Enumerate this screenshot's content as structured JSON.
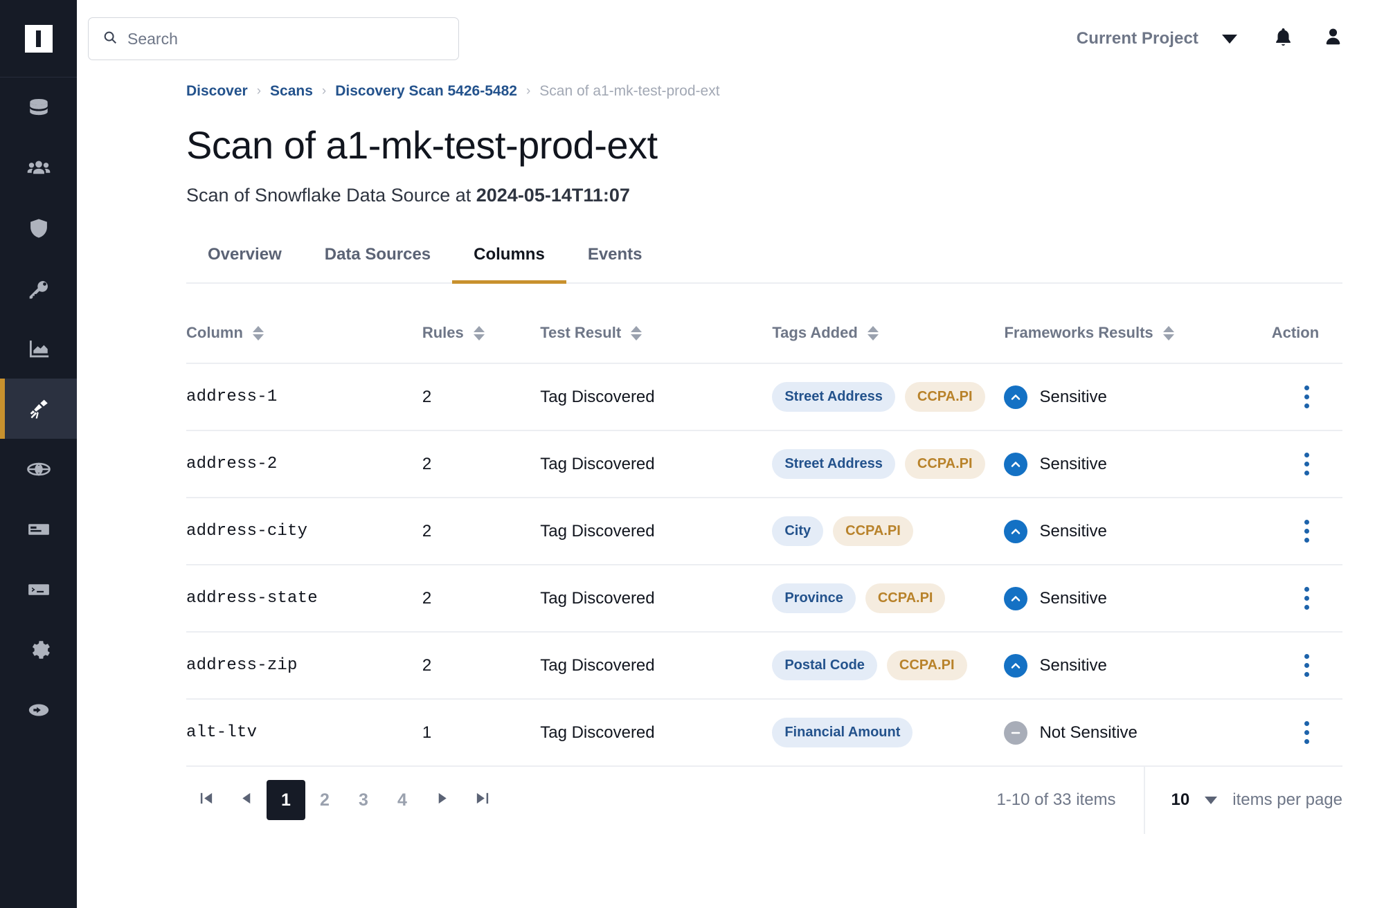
{
  "sidebar": {
    "logo_name": "immuta-logo",
    "items": [
      {
        "name": "data-sources",
        "icon": "database-icon",
        "active": false
      },
      {
        "name": "people",
        "icon": "people-icon",
        "active": false
      },
      {
        "name": "policies",
        "icon": "shield-icon",
        "active": false
      },
      {
        "name": "access",
        "icon": "key-icon",
        "active": false
      },
      {
        "name": "analytics",
        "icon": "chart-icon",
        "active": false
      },
      {
        "name": "discover",
        "icon": "telescope-icon",
        "active": true
      },
      {
        "name": "globe",
        "icon": "globe-icon",
        "active": false
      },
      {
        "name": "documents",
        "icon": "document-icon",
        "active": false
      },
      {
        "name": "terminal",
        "icon": "terminal-icon",
        "active": false
      },
      {
        "name": "settings",
        "icon": "gear-icon",
        "active": false
      },
      {
        "name": "logout",
        "icon": "arrow-right-circle-icon",
        "active": false
      }
    ]
  },
  "topbar": {
    "search_placeholder": "Search",
    "search_value": "",
    "search_icon": "search-icon",
    "project_label": "Current Project",
    "project_caret_icon": "chevron-down-icon",
    "notifications_icon": "bell-icon",
    "account_icon": "user-icon"
  },
  "breadcrumb": {
    "items": [
      {
        "label": "Discover",
        "link": true
      },
      {
        "label": "Scans",
        "link": true
      },
      {
        "label": "Discovery Scan 5426-5482",
        "link": true
      },
      {
        "label": "Scan of a1-mk-test-prod-ext",
        "link": false
      }
    ],
    "separator": "›"
  },
  "page": {
    "title": "Scan of a1-mk-test-prod-ext",
    "subtitle_prefix": "Scan of Snowflake Data Source at ",
    "subtitle_timestamp": "2024-05-14T11:07"
  },
  "tabs": [
    {
      "label": "Overview",
      "active": false
    },
    {
      "label": "Data Sources",
      "active": false
    },
    {
      "label": "Columns",
      "active": true
    },
    {
      "label": "Events",
      "active": false
    }
  ],
  "table": {
    "headers": [
      {
        "label": "Column",
        "sortable": true
      },
      {
        "label": "Rules",
        "sortable": true
      },
      {
        "label": "Test Result",
        "sortable": true
      },
      {
        "label": "Tags Added",
        "sortable": true
      },
      {
        "label": "Frameworks Results",
        "sortable": true
      },
      {
        "label": "Action",
        "sortable": false
      }
    ],
    "rows": [
      {
        "column": "address-1",
        "rules": "2",
        "test_result": "Tag Discovered",
        "tags": [
          {
            "label": "Street Address",
            "kind": "blue"
          },
          {
            "label": "CCPA.PI",
            "kind": "gold"
          }
        ],
        "framework": {
          "label": "Sensitive",
          "state": "sensitive",
          "icon": "chevron-up-circle-icon"
        }
      },
      {
        "column": "address-2",
        "rules": "2",
        "test_result": "Tag Discovered",
        "tags": [
          {
            "label": "Street Address",
            "kind": "blue"
          },
          {
            "label": "CCPA.PI",
            "kind": "gold"
          }
        ],
        "framework": {
          "label": "Sensitive",
          "state": "sensitive",
          "icon": "chevron-up-circle-icon"
        }
      },
      {
        "column": "address-city",
        "rules": "2",
        "test_result": "Tag Discovered",
        "tags": [
          {
            "label": "City",
            "kind": "blue"
          },
          {
            "label": "CCPA.PI",
            "kind": "gold"
          }
        ],
        "framework": {
          "label": "Sensitive",
          "state": "sensitive",
          "icon": "chevron-up-circle-icon"
        }
      },
      {
        "column": "address-state",
        "rules": "2",
        "test_result": "Tag Discovered",
        "tags": [
          {
            "label": "Province",
            "kind": "blue"
          },
          {
            "label": "CCPA.PI",
            "kind": "gold"
          }
        ],
        "framework": {
          "label": "Sensitive",
          "state": "sensitive",
          "icon": "chevron-up-circle-icon"
        }
      },
      {
        "column": "address-zip",
        "rules": "2",
        "test_result": "Tag Discovered",
        "tags": [
          {
            "label": "Postal Code",
            "kind": "blue"
          },
          {
            "label": "CCPA.PI",
            "kind": "gold"
          }
        ],
        "framework": {
          "label": "Sensitive",
          "state": "sensitive",
          "icon": "chevron-up-circle-icon"
        }
      },
      {
        "column": "alt-ltv",
        "rules": "1",
        "test_result": "Tag Discovered",
        "tags": [
          {
            "label": "Financial Amount",
            "kind": "blue"
          }
        ],
        "framework": {
          "label": "Not Sensitive",
          "state": "not-sensitive",
          "icon": "minus-circle-icon"
        }
      }
    ],
    "row_action_icon": "kebab-menu-icon"
  },
  "pagination": {
    "first_icon": "first-page-icon",
    "prev_icon": "previous-page-icon",
    "next_icon": "next-page-icon",
    "last_icon": "last-page-icon",
    "pages": [
      "1",
      "2",
      "3",
      "4"
    ],
    "current_page": "1",
    "range_text": "1-10 of 33 items",
    "per_page_value": "10",
    "per_page_label": "items per page",
    "per_page_caret_icon": "chevron-down-icon"
  },
  "colors": {
    "accent_gold": "#c8912e",
    "sidebar_bg": "#161b26",
    "link_blue": "#23528c",
    "tag_blue_bg": "#e4ecf7",
    "tag_gold_bg": "#f5ecdf",
    "tag_gold_text": "#b8822a",
    "sensitive_badge": "#1471c4",
    "not_sensitive_badge": "#a8adb8"
  }
}
